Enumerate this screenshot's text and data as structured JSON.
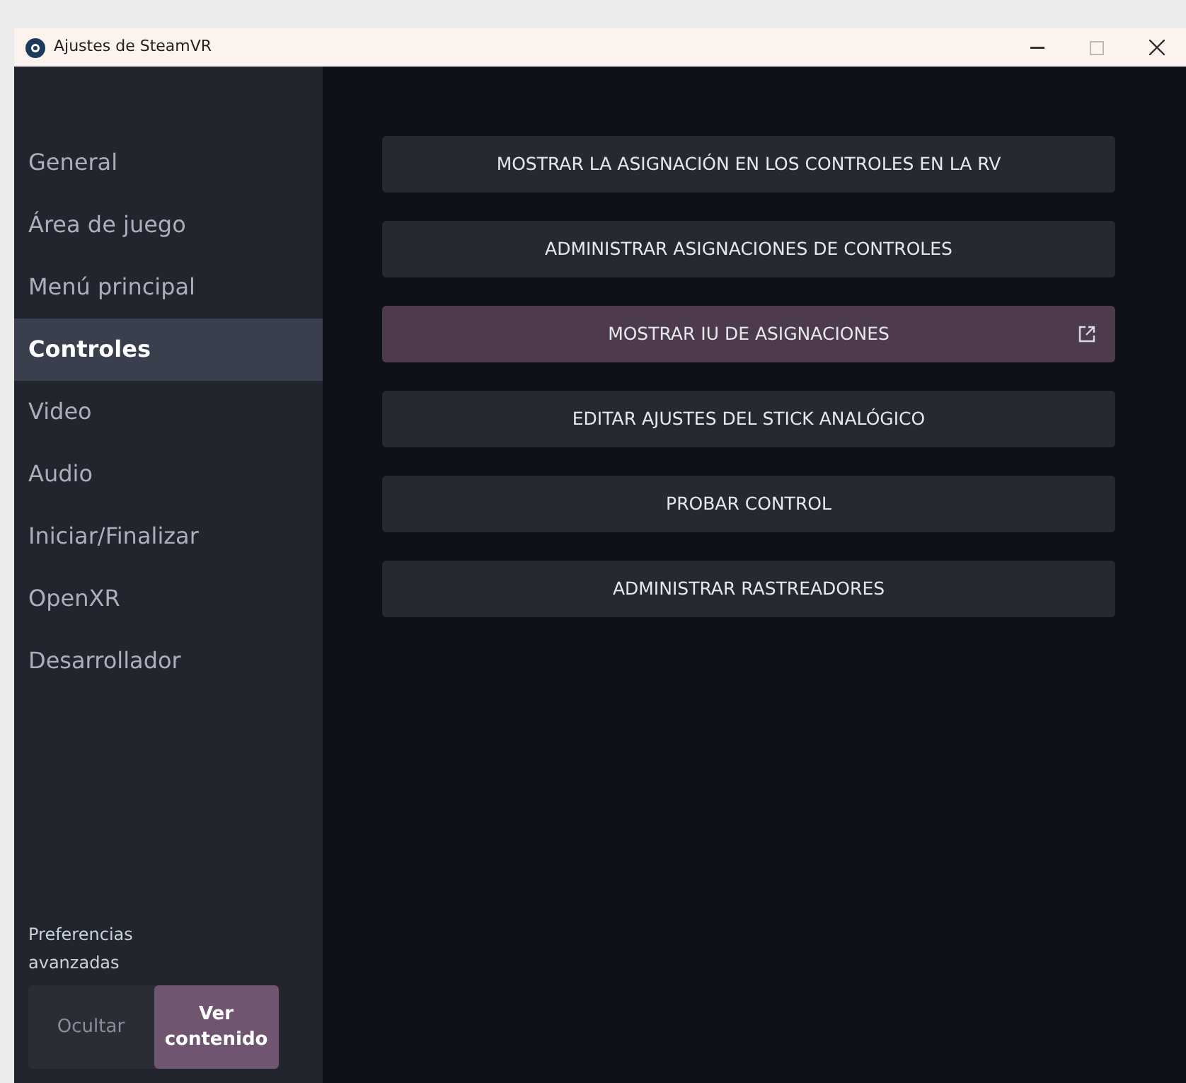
{
  "window": {
    "title": "Ajustes de SteamVR"
  },
  "sidebar": {
    "items": [
      {
        "label": "General",
        "selected": false
      },
      {
        "label": "Área de juego",
        "selected": false
      },
      {
        "label": "Menú principal",
        "selected": false
      },
      {
        "label": "Controles",
        "selected": true
      },
      {
        "label": "Video",
        "selected": false
      },
      {
        "label": "Audio",
        "selected": false
      },
      {
        "label": "Iniciar/Finalizar",
        "selected": false
      },
      {
        "label": "OpenXR",
        "selected": false
      },
      {
        "label": "Desarrollador",
        "selected": false
      }
    ],
    "advanced": {
      "label": "Preferencias avanzadas",
      "options": [
        {
          "label": "Ocultar",
          "selected": false
        },
        {
          "label": "Ver contenido",
          "selected": true
        }
      ]
    }
  },
  "actions": [
    {
      "label": "MOSTRAR LA ASIGNACIÓN EN LOS CONTROLES EN LA RV",
      "highlighted": false,
      "external": false
    },
    {
      "label": "ADMINISTRAR ASIGNACIONES DE CONTROLES",
      "highlighted": false,
      "external": false
    },
    {
      "label": "MOSTRAR IU DE ASIGNACIONES",
      "highlighted": true,
      "external": true
    },
    {
      "label": "EDITAR AJUSTES DEL STICK ANALÓGICO",
      "highlighted": false,
      "external": false
    },
    {
      "label": "PROBAR CONTROL",
      "highlighted": false,
      "external": false
    },
    {
      "label": "ADMINISTRAR RASTREADORES",
      "highlighted": false,
      "external": false
    }
  ]
}
